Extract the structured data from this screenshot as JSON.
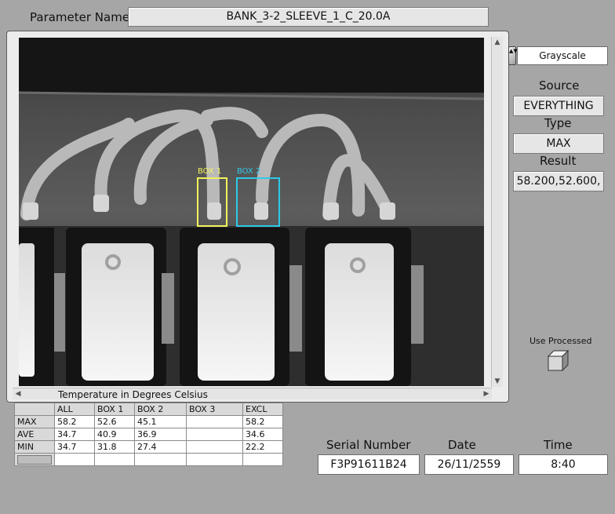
{
  "parameter": {
    "label": "Parameter Name",
    "value": "BANK_3-2_SLEEVE_1_C_20.0A"
  },
  "palette": {
    "value": "Grayscale"
  },
  "source": {
    "label": "Source",
    "value": "EVERYTHING"
  },
  "type": {
    "label": "Type",
    "value": "MAX"
  },
  "result": {
    "label": "Result",
    "value": "58.200,52.600,"
  },
  "use_processed": {
    "label": "Use Processed"
  },
  "image_caption": "Temperature in Degrees Celsius",
  "rois": [
    {
      "label": "BOX 1",
      "color": "#f2f25a"
    },
    {
      "label": "BOX 2",
      "color": "#2cc9e8"
    }
  ],
  "table": {
    "headers": [
      "",
      "ALL",
      "BOX 1",
      "BOX 2",
      "BOX 3",
      "EXCL"
    ],
    "rows": [
      [
        "MAX",
        "58.2",
        "52.6",
        "45.1",
        "",
        "58.2"
      ],
      [
        "AVE",
        "34.7",
        "40.9",
        "36.9",
        "",
        "34.6"
      ],
      [
        "MIN",
        "34.7",
        "31.8",
        "27.4",
        "",
        "22.2"
      ]
    ]
  },
  "serial": {
    "label": "Serial Number",
    "value": "F3P91611B24"
  },
  "date": {
    "label": "Date",
    "value": "26/11/2559"
  },
  "time": {
    "label": "Time",
    "value": "8:40"
  }
}
